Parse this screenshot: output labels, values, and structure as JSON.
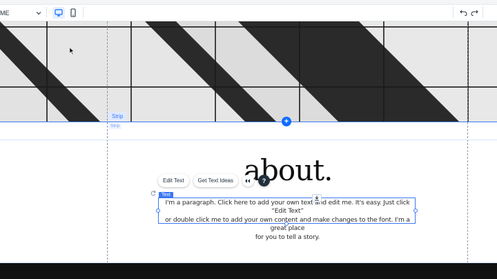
{
  "toolbar": {
    "page_name": "ME",
    "icons": [
      "chevron-down-icon",
      "desktop-icon",
      "mobile-icon",
      "undo-icon",
      "redo-icon"
    ],
    "desktop_active": true
  },
  "canvas": {
    "strip_label": "Strip",
    "strip_sub_label": "Strip",
    "about_title": "about.",
    "float_toolbar": {
      "edit_text": "Edit Text",
      "get_text_ideas": "Get Text Ideas",
      "help_symbol": "?"
    },
    "text_tag": "Text",
    "add_symbol": "+",
    "paragraph_lines": [
      "I'm a paragraph. Click here to add your own text and edit me. It's easy. Just click “Edit Text”",
      "or double click me to add your own content and make changes to the font. I'm a great place",
      "for you to tell a story."
    ]
  },
  "colors": {
    "accent": "#116dff",
    "selection": "#3a78f2",
    "hero_dark": "#2a2a2a",
    "hero_light": "#e8e8e8"
  }
}
